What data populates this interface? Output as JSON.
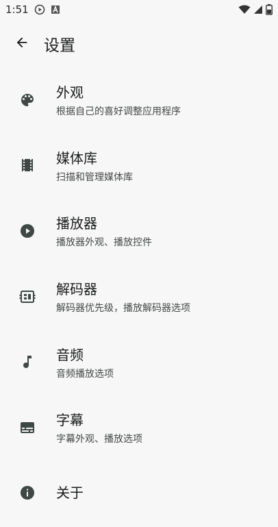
{
  "status_bar": {
    "time": "1:51",
    "icons": [
      "play-circle-icon",
      "font-a-icon",
      "wifi-icon",
      "cellular-icon",
      "battery-icon"
    ]
  },
  "app_bar": {
    "back_icon": "arrow-back-icon",
    "title": "设置"
  },
  "settings": [
    {
      "id": "appearance",
      "icon": "palette-icon",
      "title": "外观",
      "subtitle": "根据自己的喜好调整应用程序"
    },
    {
      "id": "media-library",
      "icon": "film-icon",
      "title": "媒体库",
      "subtitle": "扫描和管理媒体库"
    },
    {
      "id": "player",
      "icon": "play-circle-icon",
      "title": "播放器",
      "subtitle": "播放器外观、播放控件"
    },
    {
      "id": "decoder",
      "icon": "decoder-chip-icon",
      "title": "解码器",
      "subtitle": "解码器优先级，播放解码器选项"
    },
    {
      "id": "audio",
      "icon": "music-note-icon",
      "title": "音频",
      "subtitle": "音频播放选项"
    },
    {
      "id": "subtitles",
      "icon": "subtitles-icon",
      "title": "字幕",
      "subtitle": "字幕外观、播放选项"
    },
    {
      "id": "about",
      "icon": "info-icon",
      "title": "关于",
      "subtitle": ""
    }
  ],
  "colors": {
    "background": "#f6f7f6",
    "icon": "#3f4845",
    "text_primary": "#1a1c1b",
    "text_secondary": "#444846"
  }
}
